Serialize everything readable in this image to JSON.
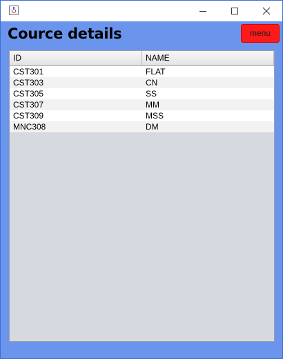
{
  "window": {
    "title": "",
    "controls": {
      "minimize": "minimize-icon",
      "maximize": "maximize-icon",
      "close": "close-icon"
    }
  },
  "header": {
    "title": "Cource details",
    "menu_label": "menu"
  },
  "table": {
    "columns": [
      "ID",
      "NAME"
    ],
    "rows": [
      [
        "CST301",
        "FLAT"
      ],
      [
        "CST303",
        "CN"
      ],
      [
        "CST305",
        "SS"
      ],
      [
        "CST307",
        "MM"
      ],
      [
        "CST309",
        "MSS"
      ],
      [
        "MNC308",
        "DM"
      ]
    ]
  },
  "colors": {
    "frame": "#6b95ec",
    "menu_button": "#ff1a1a",
    "table_empty_area": "#d6d9df"
  }
}
